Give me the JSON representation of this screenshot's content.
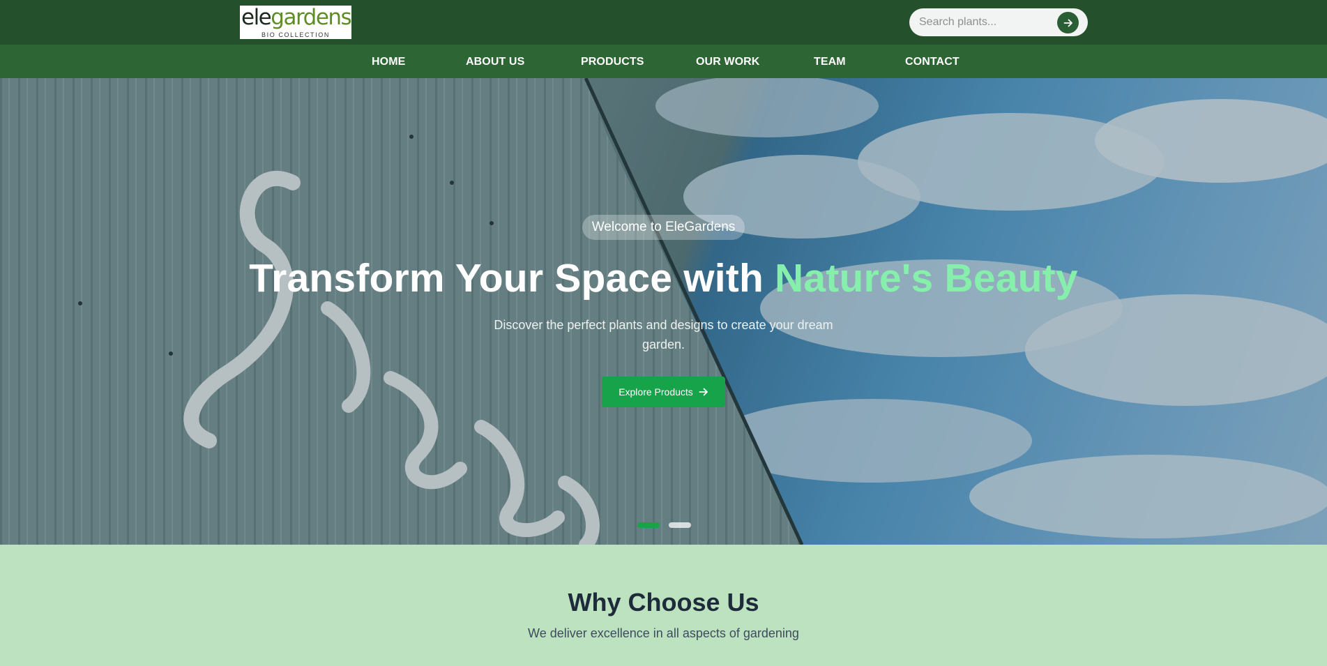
{
  "header": {
    "logo": {
      "word_part1": "ele",
      "word_part2": "gardens",
      "tagline": "BIO COLLECTION"
    },
    "search": {
      "placeholder": "Search plants...",
      "value": ""
    }
  },
  "nav": {
    "items": [
      {
        "label": "HOME"
      },
      {
        "label": "ABOUT US"
      },
      {
        "label": "PRODUCTS"
      },
      {
        "label": "OUR WORK"
      },
      {
        "label": "TEAM"
      },
      {
        "label": "CONTACT"
      }
    ]
  },
  "hero": {
    "badge": "Welcome to EleGardens",
    "headline_part1": "Transform Your Space with ",
    "headline_part2": "Nature's Beauty",
    "subtitle": "Discover the perfect plants and designs to create your dream garden.",
    "cta_label": "Explore Products",
    "slides": {
      "count": 2,
      "active": 1
    }
  },
  "why": {
    "title": "Why Choose Us",
    "subtitle": "We deliver excellence in all aspects of gardening"
  },
  "colors": {
    "topbar": "#24512b",
    "navbar": "#2d6634",
    "accent_green": "#16a34a",
    "headline_highlight": "#86efac",
    "section_bg": "#bde2bf"
  },
  "icons": {
    "search_button": "arrow-right-icon",
    "cta": "arrow-right-icon"
  }
}
